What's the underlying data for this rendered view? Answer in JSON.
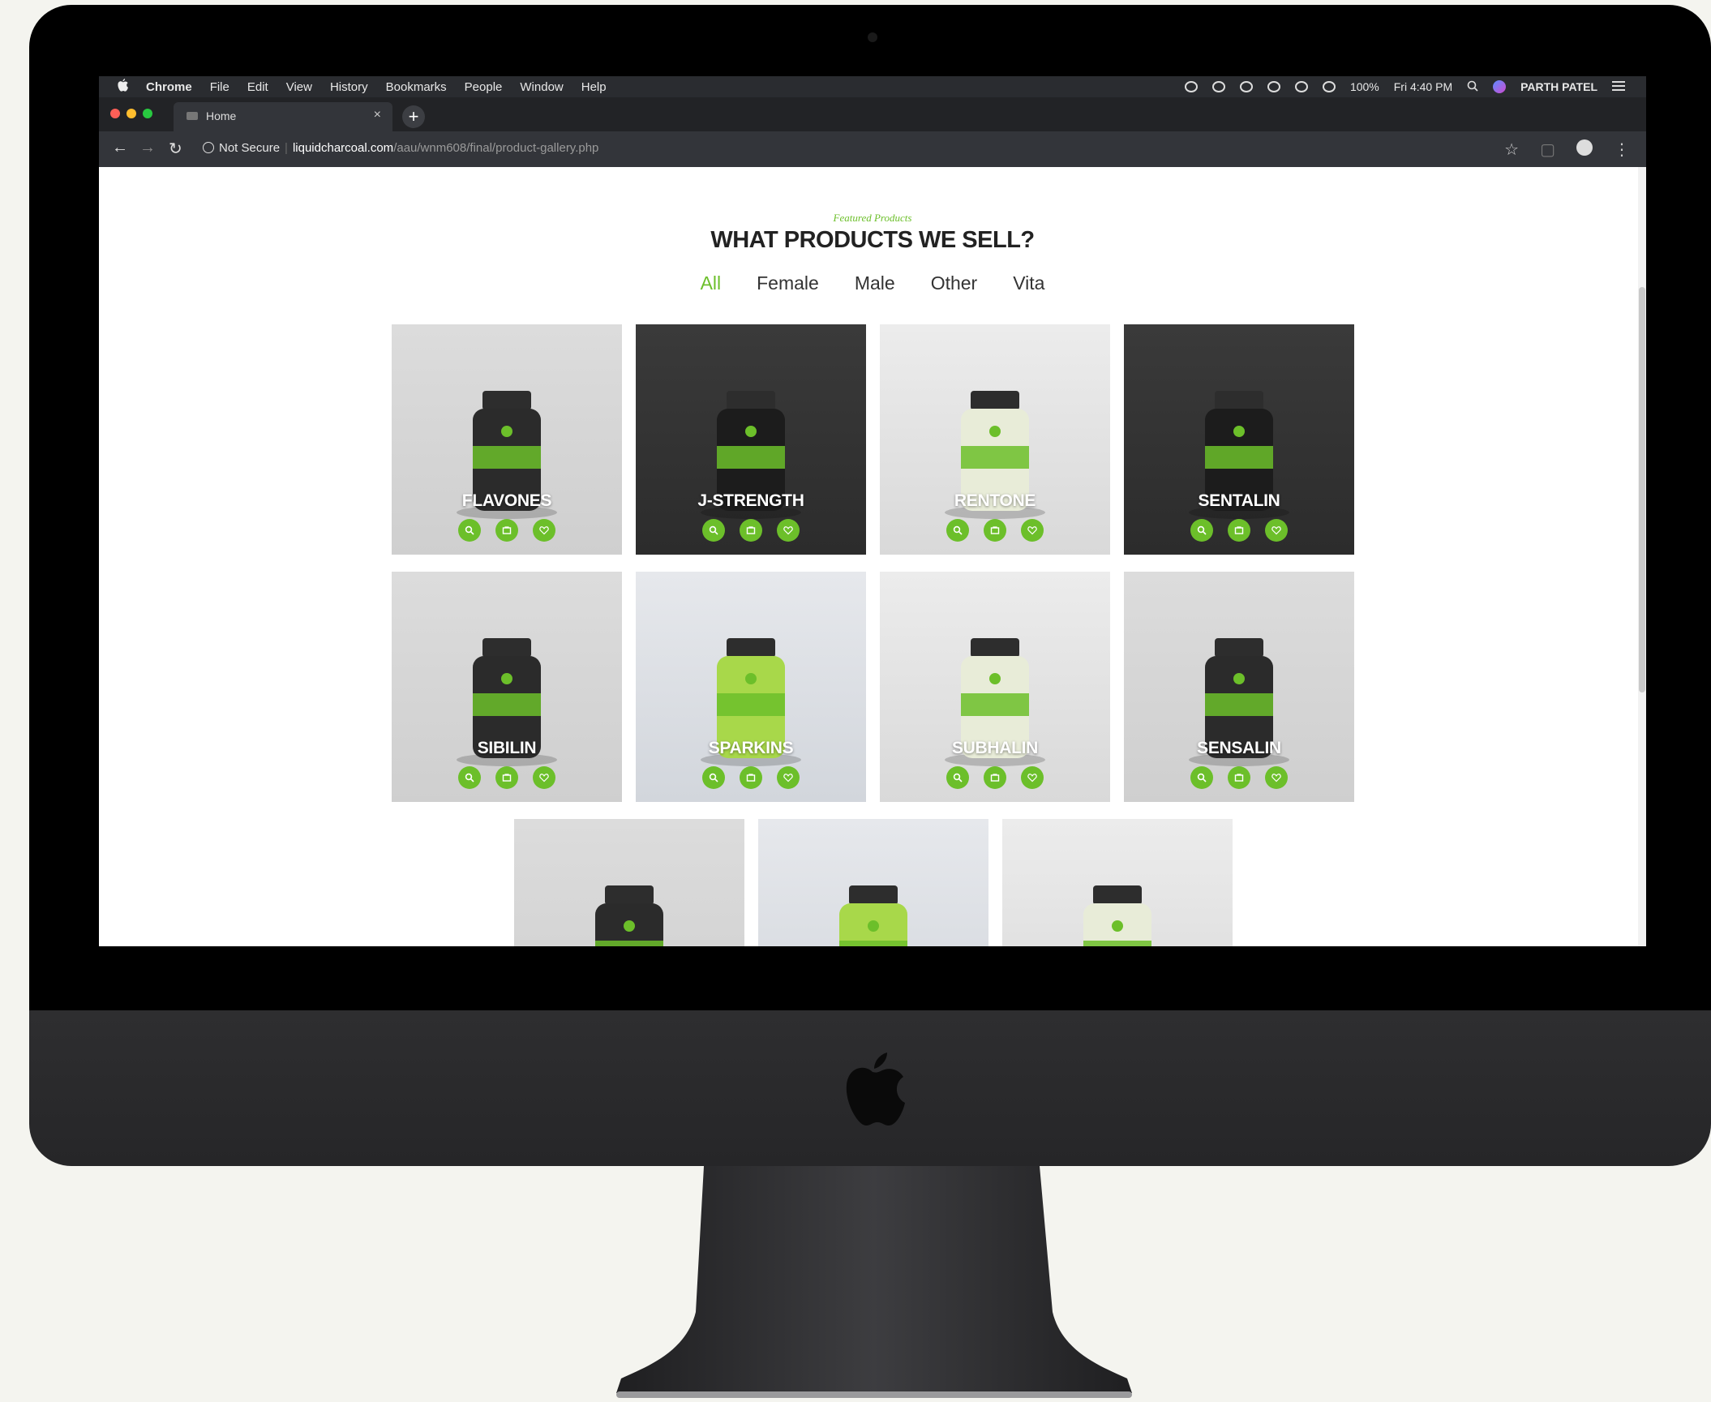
{
  "menubar": {
    "apple": "",
    "items": [
      "Chrome",
      "File",
      "Edit",
      "View",
      "History",
      "Bookmarks",
      "People",
      "Window",
      "Help"
    ],
    "battery": "100%",
    "clock": "Fri 4:40 PM",
    "user": "PARTH PATEL"
  },
  "tabs": [
    {
      "title": "Home",
      "close": "×"
    }
  ],
  "new_tab": "+",
  "address": {
    "security": "Not Secure",
    "domain": "liquidcharcoal.com",
    "path": "/aau/wnm608/final/product-gallery.php"
  },
  "page": {
    "eyebrow": "Featured Products",
    "headline": "WHAT PRODUCTS WE SELL?",
    "filters": [
      "All",
      "Female",
      "Male",
      "Other",
      "Vita"
    ],
    "active_filter": "All",
    "accent_color": "#6cbf2a"
  },
  "products": [
    {
      "name": "FLAVONES",
      "bg": "light"
    },
    {
      "name": "J-STRENGTH",
      "bg": "dark"
    },
    {
      "name": "RENTONE",
      "bg": "pale"
    },
    {
      "name": "SENTALIN",
      "bg": "dark"
    },
    {
      "name": "SIBILIN",
      "bg": "light"
    },
    {
      "name": "SPARKINS",
      "bg": "blue"
    },
    {
      "name": "SUBHALIN",
      "bg": "pale"
    },
    {
      "name": "SENSALIN",
      "bg": "light"
    },
    {
      "name": "",
      "bg": "light"
    },
    {
      "name": "",
      "bg": "blue"
    },
    {
      "name": "",
      "bg": "pale"
    }
  ],
  "card_actions": [
    "search-icon",
    "cart-icon",
    "heart-icon"
  ]
}
